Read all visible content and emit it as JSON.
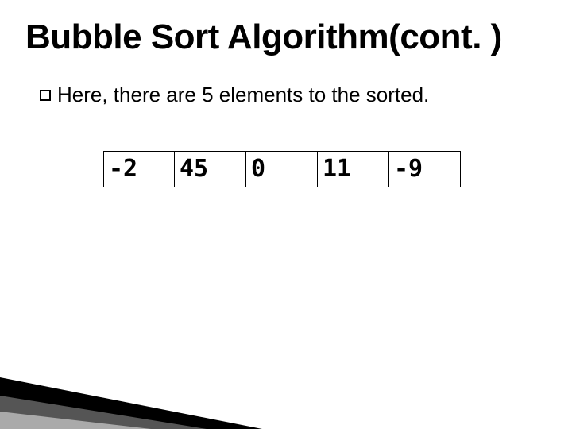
{
  "title": "Bubble Sort Algorithm(cont. )",
  "body": {
    "bullet_prefix": "Here,",
    "rest": " there are 5 elements to the sorted."
  },
  "array": [
    "-2",
    "45",
    "0",
    "11",
    "-9"
  ]
}
